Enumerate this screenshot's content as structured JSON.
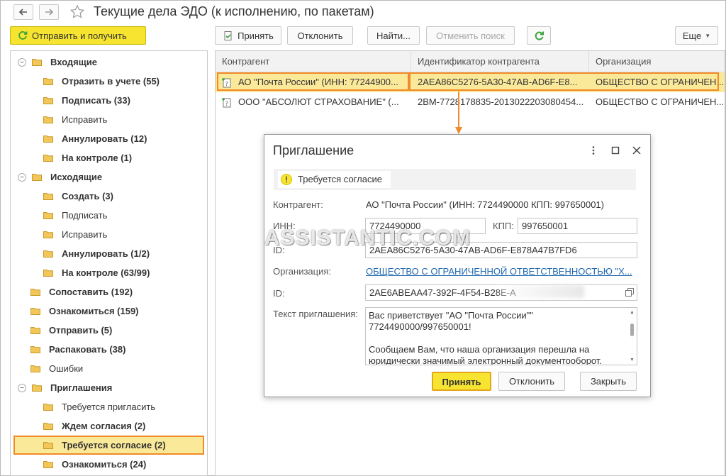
{
  "window": {
    "title": "Текущие дела ЭДО (к исполнению, по пакетам)"
  },
  "send_button": "Отправить и получить",
  "toolbar": {
    "accept": "Принять",
    "reject": "Отклонить",
    "find": "Найти...",
    "cancel_search": "Отменить поиск",
    "more": "Еще"
  },
  "tree": [
    {
      "label": "Входящие",
      "bold": true,
      "toggle": true
    },
    {
      "label": "Отразить в учете (55)",
      "bold": true
    },
    {
      "label": "Подписать (33)",
      "bold": true
    },
    {
      "label": "Исправить",
      "bold": false
    },
    {
      "label": "Аннулировать (12)",
      "bold": true
    },
    {
      "label": "На контроле (1)",
      "bold": true
    },
    {
      "label": "Исходящие",
      "bold": true,
      "toggle": true
    },
    {
      "label": "Создать (3)",
      "bold": true
    },
    {
      "label": "Подписать",
      "bold": false
    },
    {
      "label": "Исправить",
      "bold": false
    },
    {
      "label": "Аннулировать (1/2)",
      "bold": true
    },
    {
      "label": "На контроле (63/99)",
      "bold": true
    },
    {
      "label": "Сопоставить (192)",
      "bold": true
    },
    {
      "label": "Ознакомиться (159)",
      "bold": true
    },
    {
      "label": "Отправить (5)",
      "bold": true
    },
    {
      "label": "Распаковать (38)",
      "bold": true
    },
    {
      "label": "Ошибки",
      "bold": false
    },
    {
      "label": "Приглашения",
      "bold": true,
      "toggle": true
    },
    {
      "label": "Требуется пригласить",
      "bold": false
    },
    {
      "label": "Ждем согласия (2)",
      "bold": true
    },
    {
      "label": "Требуется согласие (2)",
      "bold": true,
      "selected": true
    },
    {
      "label": "Ознакомиться (24)",
      "bold": true
    }
  ],
  "table": {
    "columns": [
      "Контрагент",
      "Идентификатор контрагента",
      "Организация"
    ],
    "rows": [
      [
        "АО \"Почта России\" (ИНН: 77244900...",
        "2AEA86C5276-5A30-47AB-AD6F-E8...",
        "ОБЩЕСТВО С ОГРАНИЧЕН..."
      ],
      [
        "ООО \"АБСОЛЮТ СТРАХОВАНИЕ\" (...",
        "2BM-7728178835-2013022203080454...",
        "ОБЩЕСТВО С ОГРАНИЧЕН..."
      ]
    ]
  },
  "dialog": {
    "title": "Приглашение",
    "status": "Требуется согласие",
    "counterparty_label": "Контрагент:",
    "counterparty_value": "АО \"Почта России\" (ИНН: 7724490000 КПП: 997650001)",
    "inn_label": "ИНН:",
    "inn_value": "7724490000",
    "kpp_label": "КПП:",
    "kpp_value": "997650001",
    "id_label": "ID:",
    "id_value": "2AEA86C5276-5A30-47AB-AD6F-E878A47B7FD6",
    "org_label": "Организация:",
    "org_value": "ОБЩЕСТВО С ОГРАНИЧЕННОЙ ОТВЕТСТВЕННОСТЬЮ \"Х...",
    "id2_label": "ID:",
    "id2_value": "2AE6ABEAA47-392F-4F54-B28E-A",
    "invite_label": "Текст приглашения:",
    "invite_text": "Вас приветствует \"АО \"Почта России\"\"\n7724490000/997650001!\n\nСообщаем Вам, что наша организация перешла на\nюридически значимый электронный документооборот.",
    "accept": "Принять",
    "reject": "Отклонить",
    "close": "Закрыть"
  },
  "watermark": "ASSISTANTIC.COM",
  "colors": {
    "accent_yellow": "#f6e430",
    "highlight_orange": "#f08a2a",
    "link_blue": "#2168b0",
    "refresh_green": "#3aa33a"
  }
}
